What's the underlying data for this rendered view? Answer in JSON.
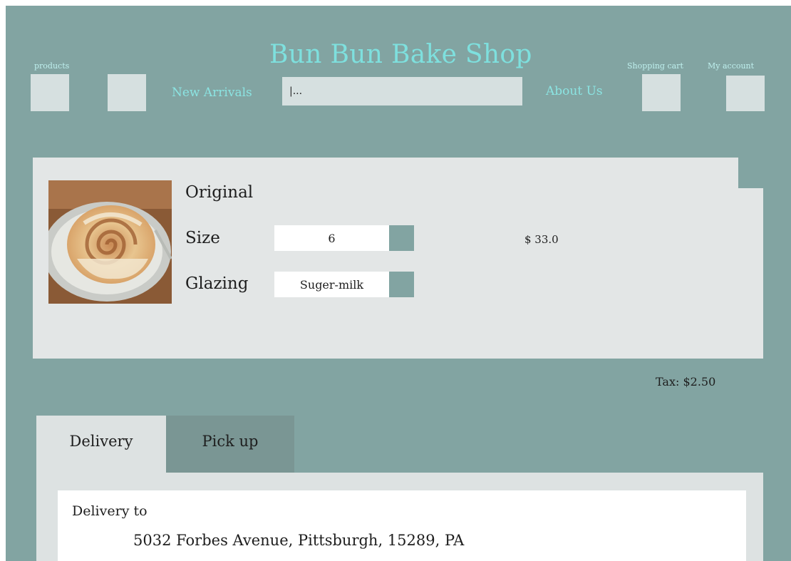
{
  "header": {
    "brand": "Bun Bun Bake Shop",
    "products_label": "products",
    "new_arrivals": "New Arrivals",
    "about_us": "About Us",
    "shopping_cart_label": "Shopping cart",
    "my_account_label": "My account",
    "search_placeholder": "|..."
  },
  "cart_item": {
    "name": "Original",
    "image_icon": "cinnamon-roll-photo",
    "size_label": "Size",
    "size_value": "6",
    "glazing_label": "Glazing",
    "glazing_value": "Suger-milk",
    "price": "$ 33.0"
  },
  "summary": {
    "tax": "Tax:  $2.50"
  },
  "fulfillment": {
    "tabs": [
      {
        "label": "Delivery",
        "active": true
      },
      {
        "label": "Pick up",
        "active": false
      }
    ],
    "delivery_to_label": "Delivery to",
    "address": "5032 Forbes Avenue, Pittsburgh, 15289, PA"
  },
  "colors": {
    "background": "#82a4a2",
    "brand_text": "#7ee0de",
    "card": "#e3e6e6",
    "placeholder_box": "#d6e0e0",
    "tab_inactive": "#7a9694"
  }
}
